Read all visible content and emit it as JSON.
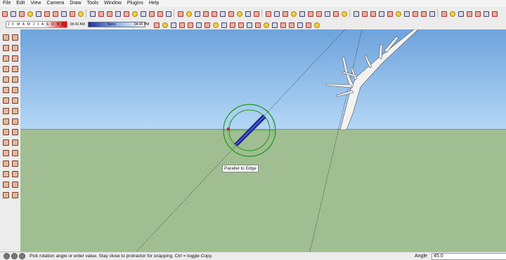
{
  "menu": {
    "items": [
      "File",
      "Edit",
      "View",
      "Camera",
      "Draw",
      "Tools",
      "Window",
      "Plugins",
      "Help"
    ]
  },
  "shadows": {
    "months": "J F M A M J J A S O N D",
    "time_start": "06:42 AM",
    "time_noon": "Noon",
    "time_end": "04:46 PM"
  },
  "viewport": {
    "tooltip": "Parallel to Edge",
    "sky_color": "#8bbde8",
    "ground_color": "#a1be92",
    "protractor_color": "#1a9a1a",
    "selection_color": "#2030a0"
  },
  "status": {
    "message": "Pick rotation angle or enter value.  Stay close to protractor for snapping. Ctrl = toggle Copy.",
    "measurement_label": "Angle",
    "measurement_value": "45.0"
  },
  "icons": {
    "toolbar1": [
      "select-icon",
      "make-component-icon",
      "eraser-icon",
      "paint-bucket-icon",
      "rectangle-icon",
      "line-icon",
      "circle-icon",
      "arc-icon",
      "polygon-icon",
      "freehand-icon",
      "move-icon",
      "push-pull-icon",
      "rotate-icon",
      "follow-me-icon",
      "scale-icon",
      "offset-icon",
      "tape-measure-icon",
      "protractor-icon",
      "dimension-icon",
      "text-icon",
      "axes-icon",
      "3d-text-icon",
      "orbit-icon",
      "pan-icon",
      "zoom-icon",
      "zoom-window-icon",
      "zoom-extents-icon",
      "previous-view-icon",
      "next-view-icon",
      "iso-view-icon",
      "top-view-icon",
      "front-view-icon",
      "right-view-icon",
      "back-view-icon",
      "left-view-icon",
      "xray-icon",
      "wireframe-icon",
      "hidden-line-icon",
      "shaded-icon",
      "shaded-texture-icon",
      "monochrome-icon",
      "section-plane-icon",
      "display-sections-icon",
      "get-models-icon",
      "share-model-icon",
      "add-location-icon",
      "toggle-terrain-icon",
      "photo-textures-icon",
      "extension-warehouse-icon",
      "ruby-console-icon",
      "model-info-icon",
      "layer-manager-icon",
      "styles-icon",
      "shadow-settings-icon",
      "fog-icon",
      "outliner-icon",
      "scenes-icon"
    ],
    "toolbar2": [
      "position-camera-icon",
      "look-around-icon",
      "walk-icon",
      "sandbox-from-contours-icon",
      "sandbox-from-scratch-icon",
      "smoove-icon",
      "stamp-icon",
      "drape-icon",
      "add-detail-icon",
      "flip-edge-icon",
      "intersect-icon",
      "union-icon",
      "subtract-icon",
      "trim-icon",
      "split-icon",
      "outer-shell-icon",
      "solid-inspector-icon",
      "dynamic-component-icon",
      "component-attributes-icon",
      "interact-icon"
    ],
    "left_toolbar": [
      "select-icon",
      "make-component-icon",
      "paint-bucket-icon",
      "eraser-icon",
      "rectangle-icon",
      "line-icon",
      "circle-icon",
      "arc-icon",
      "polygon-icon",
      "freehand-icon",
      "move-icon",
      "push-pull-icon",
      "rotate-icon",
      "follow-me-icon",
      "scale-icon",
      "offset-icon",
      "tape-measure-icon",
      "dimension-icon",
      "protractor-icon",
      "text-icon",
      "axes-icon",
      "3d-text-icon",
      "orbit-icon",
      "pan-icon",
      "zoom-icon",
      "zoom-window-icon",
      "zoom-extents-icon",
      "previous-view-icon",
      "position-camera-icon",
      "walk-icon",
      "look-around-icon",
      "section-plane-icon"
    ],
    "status": [
      "geo-location-icon",
      "credits-icon",
      "user-icon",
      "help-icon"
    ]
  }
}
